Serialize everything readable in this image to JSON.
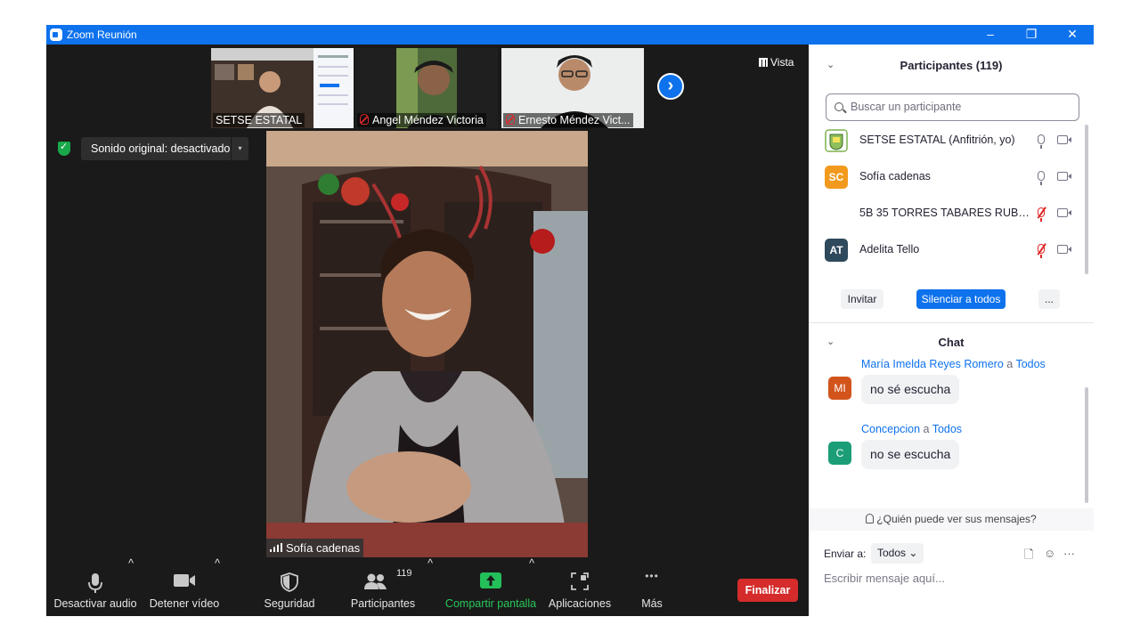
{
  "window": {
    "title": "Zoom Reunión",
    "controls": [
      "–",
      "❐",
      "✕"
    ]
  },
  "gallery": {
    "thumbnails": [
      {
        "name": "SETSE ESTATAL",
        "muted": false
      },
      {
        "name": "Angel Méndez Victoria",
        "muted": true
      },
      {
        "name": "Ernesto Méndez Vict...",
        "muted": true
      }
    ],
    "next_arrow": "›",
    "view_label": "Vista"
  },
  "video": {
    "sound_pill": "Sonido original: desactivado",
    "sound_caret": "▾",
    "speaker_name": "Sofía cadenas"
  },
  "toolbar": {
    "audio": "Desactivar audio",
    "video": "Detener vídeo",
    "security": "Seguridad",
    "participants": "Participantes",
    "participants_count": "119",
    "share": "Compartir pantalla",
    "apps": "Aplicaciones",
    "more": "Más",
    "end": "Finalizar",
    "caret": "^",
    "more_dots": "•••"
  },
  "participants": {
    "header": "Participantes (119)",
    "collapse": "⌄",
    "search_placeholder": "Buscar un participante",
    "list": [
      {
        "avatar": "",
        "avatar_color": "#8fbf5a",
        "name": "SETSE ESTATAL (Anfitrión, yo)",
        "mic_muted": false
      },
      {
        "avatar": "SC",
        "avatar_color": "#f29a1d",
        "name": "Sofía cadenas",
        "mic_muted": false
      },
      {
        "avatar": "",
        "avatar_color": "#ffffff",
        "name": "5B 35 TORRES TABARES RUBEN ...",
        "mic_muted": true
      },
      {
        "avatar": "AT",
        "avatar_color": "#2f4a5c",
        "name": "Adelita Tello",
        "mic_muted": true
      }
    ],
    "invite": "Invitar",
    "mute_all": "Silenciar a todos",
    "more": "..."
  },
  "chat": {
    "header": "Chat",
    "collapse": "⌄",
    "messages": [
      {
        "avatar": "MI",
        "avatar_color": "#d2541c",
        "sender": "María Imelda Reyes Romero",
        "connector": " a ",
        "to": "Todos",
        "text": "no sé  escucha"
      },
      {
        "avatar": "C",
        "avatar_color": "#1b9e77",
        "sender": "Concepcion",
        "connector": " a ",
        "to": "Todos",
        "text": "no se escucha"
      }
    ],
    "who_can_see": "¿Quién puede ver sus mensajes?",
    "send_to_label": "Enviar a:",
    "send_to_value": "Todos",
    "dropdown_caret": "⌄",
    "file_icon": "🗋",
    "emoji_icon": "☺",
    "more_icon": "···",
    "input_placeholder": "Escribir mensaje aquí..."
  }
}
